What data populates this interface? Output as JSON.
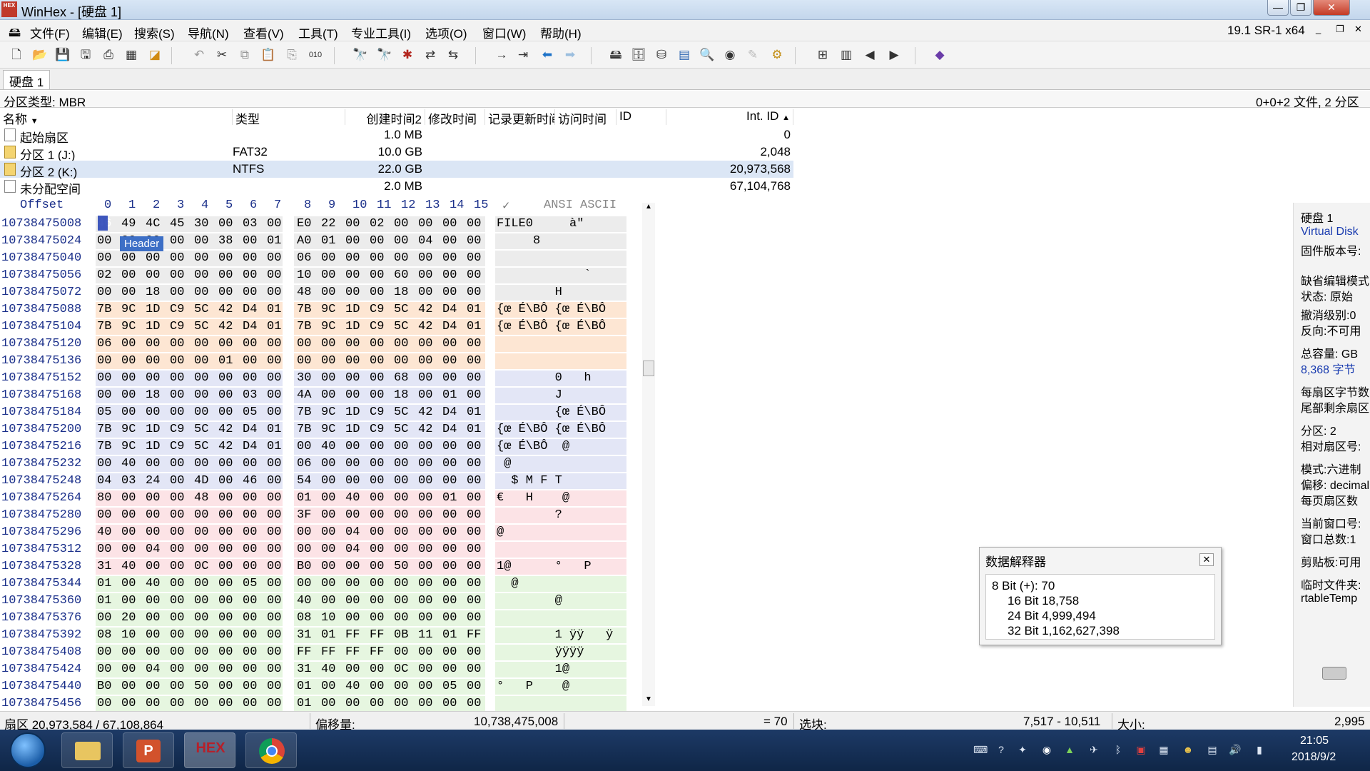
{
  "window": {
    "title": "WinHex - [硬盘 1]",
    "version": "19.1 SR-1 x64",
    "app_icon_text": "HEX"
  },
  "menu": [
    "文件(F)",
    "编辑(E)",
    "搜索(S)",
    "导航(N)",
    "查看(V)",
    "工具(T)",
    "专业工具(I)",
    "选项(O)",
    "窗口(W)",
    "帮助(H)"
  ],
  "tab": {
    "label": "硬盘 1"
  },
  "info": {
    "partition_type": "分区类型: MBR",
    "summary": "0+0+2 文件, 2 分区"
  },
  "partition_list": {
    "headers": [
      "名称",
      "类型",
      "创建时间2",
      "修改时间",
      "记录更新时间",
      "访问时间",
      "ID",
      "Int. ID"
    ],
    "rows": [
      {
        "name": "起始扇区",
        "type": "",
        "size": "1.0 MB",
        "int_id": "0"
      },
      {
        "name": "分区 1 (J:)",
        "type": "FAT32",
        "size": "10.0 GB",
        "int_id": "2,048"
      },
      {
        "name": "分区 2 (K:)",
        "type": "NTFS",
        "size": "22.0 GB",
        "int_id": "20,973,568"
      },
      {
        "name": "未分配空间",
        "type": "",
        "size": "2.0 MB",
        "int_id": "67,104,768"
      }
    ]
  },
  "hex": {
    "offset_header": "Offset",
    "col_headers": [
      "0",
      "1",
      "2",
      "3",
      "4",
      "5",
      "6",
      "7",
      "8",
      "9",
      "10",
      "11",
      "12",
      "13",
      "14",
      "15"
    ],
    "ascii_header": "ANSI ASCII",
    "ascii_pencil": "✓",
    "tooltip": "Header",
    "rows": [
      {
        "off": "10738475008",
        "b": [
          "46",
          "49",
          "4C",
          "45",
          "30",
          "00",
          "03",
          "00",
          "E0",
          "22",
          "00",
          "02",
          "00",
          "00",
          "00",
          "00"
        ],
        "a": "FILE0     à\"     "
      },
      {
        "off": "10738475024",
        "b": [
          "00",
          "00",
          "00",
          "00",
          "00",
          "38",
          "00",
          "01",
          "A0",
          "01",
          "00",
          "00",
          "00",
          "04",
          "00",
          "00"
        ],
        "a": "     8          "
      },
      {
        "off": "10738475040",
        "b": [
          "00",
          "00",
          "00",
          "00",
          "00",
          "00",
          "00",
          "00",
          "06",
          "00",
          "00",
          "00",
          "00",
          "00",
          "00",
          "00"
        ],
        "a": "                "
      },
      {
        "off": "10738475056",
        "b": [
          "02",
          "00",
          "00",
          "00",
          "00",
          "00",
          "00",
          "00",
          "10",
          "00",
          "00",
          "00",
          "60",
          "00",
          "00",
          "00"
        ],
        "a": "            `   "
      },
      {
        "off": "10738475072",
        "b": [
          "00",
          "00",
          "18",
          "00",
          "00",
          "00",
          "00",
          "00",
          "48",
          "00",
          "00",
          "00",
          "18",
          "00",
          "00",
          "00"
        ],
        "a": "        H       "
      },
      {
        "off": "10738475088",
        "b": [
          "7B",
          "9C",
          "1D",
          "C9",
          "5C",
          "42",
          "D4",
          "01",
          "7B",
          "9C",
          "1D",
          "C9",
          "5C",
          "42",
          "D4",
          "01"
        ],
        "a": "{œ É\\BÔ {œ É\\BÔ "
      },
      {
        "off": "10738475104",
        "b": [
          "7B",
          "9C",
          "1D",
          "C9",
          "5C",
          "42",
          "D4",
          "01",
          "7B",
          "9C",
          "1D",
          "C9",
          "5C",
          "42",
          "D4",
          "01"
        ],
        "a": "{œ É\\BÔ {œ É\\BÔ "
      },
      {
        "off": "10738475120",
        "b": [
          "06",
          "00",
          "00",
          "00",
          "00",
          "00",
          "00",
          "00",
          "00",
          "00",
          "00",
          "00",
          "00",
          "00",
          "00",
          "00"
        ],
        "a": "                "
      },
      {
        "off": "10738475136",
        "b": [
          "00",
          "00",
          "00",
          "00",
          "00",
          "01",
          "00",
          "00",
          "00",
          "00",
          "00",
          "00",
          "00",
          "00",
          "00",
          "00"
        ],
        "a": "                "
      },
      {
        "off": "10738475152",
        "b": [
          "00",
          "00",
          "00",
          "00",
          "00",
          "00",
          "00",
          "00",
          "30",
          "00",
          "00",
          "00",
          "68",
          "00",
          "00",
          "00"
        ],
        "a": "        0   h   "
      },
      {
        "off": "10738475168",
        "b": [
          "00",
          "00",
          "18",
          "00",
          "00",
          "00",
          "03",
          "00",
          "4A",
          "00",
          "00",
          "00",
          "18",
          "00",
          "01",
          "00"
        ],
        "a": "        J       "
      },
      {
        "off": "10738475184",
        "b": [
          "05",
          "00",
          "00",
          "00",
          "00",
          "00",
          "05",
          "00",
          "7B",
          "9C",
          "1D",
          "C9",
          "5C",
          "42",
          "D4",
          "01"
        ],
        "a": "        {œ É\\BÔ "
      },
      {
        "off": "10738475200",
        "b": [
          "7B",
          "9C",
          "1D",
          "C9",
          "5C",
          "42",
          "D4",
          "01",
          "7B",
          "9C",
          "1D",
          "C9",
          "5C",
          "42",
          "D4",
          "01"
        ],
        "a": "{œ É\\BÔ {œ É\\BÔ "
      },
      {
        "off": "10738475216",
        "b": [
          "7B",
          "9C",
          "1D",
          "C9",
          "5C",
          "42",
          "D4",
          "01",
          "00",
          "40",
          "00",
          "00",
          "00",
          "00",
          "00",
          "00"
        ],
        "a": "{œ É\\BÔ  @      "
      },
      {
        "off": "10738475232",
        "b": [
          "00",
          "40",
          "00",
          "00",
          "00",
          "00",
          "00",
          "00",
          "06",
          "00",
          "00",
          "00",
          "00",
          "00",
          "00",
          "00"
        ],
        "a": " @              "
      },
      {
        "off": "10738475248",
        "b": [
          "04",
          "03",
          "24",
          "00",
          "4D",
          "00",
          "46",
          "00",
          "54",
          "00",
          "00",
          "00",
          "00",
          "00",
          "00",
          "00"
        ],
        "a": "  $ M F T       "
      },
      {
        "off": "10738475264",
        "b": [
          "80",
          "00",
          "00",
          "00",
          "48",
          "00",
          "00",
          "00",
          "01",
          "00",
          "40",
          "00",
          "00",
          "00",
          "01",
          "00"
        ],
        "a": "€   H    @      "
      },
      {
        "off": "10738475280",
        "b": [
          "00",
          "00",
          "00",
          "00",
          "00",
          "00",
          "00",
          "00",
          "3F",
          "00",
          "00",
          "00",
          "00",
          "00",
          "00",
          "00"
        ],
        "a": "        ?       "
      },
      {
        "off": "10738475296",
        "b": [
          "40",
          "00",
          "00",
          "00",
          "00",
          "00",
          "00",
          "00",
          "00",
          "00",
          "04",
          "00",
          "00",
          "00",
          "00",
          "00"
        ],
        "a": "@               "
      },
      {
        "off": "10738475312",
        "b": [
          "00",
          "00",
          "04",
          "00",
          "00",
          "00",
          "00",
          "00",
          "00",
          "00",
          "04",
          "00",
          "00",
          "00",
          "00",
          "00"
        ],
        "a": "                "
      },
      {
        "off": "10738475328",
        "b": [
          "31",
          "40",
          "00",
          "00",
          "0C",
          "00",
          "00",
          "00",
          "B0",
          "00",
          "00",
          "00",
          "50",
          "00",
          "00",
          "00"
        ],
        "a": "1@      °   P   "
      },
      {
        "off": "10738475344",
        "b": [
          "01",
          "00",
          "40",
          "00",
          "00",
          "00",
          "05",
          "00",
          "00",
          "00",
          "00",
          "00",
          "00",
          "00",
          "00",
          "00"
        ],
        "a": "  @             "
      },
      {
        "off": "10738475360",
        "b": [
          "01",
          "00",
          "00",
          "00",
          "00",
          "00",
          "00",
          "00",
          "40",
          "00",
          "00",
          "00",
          "00",
          "00",
          "00",
          "00"
        ],
        "a": "        @       "
      },
      {
        "off": "10738475376",
        "b": [
          "00",
          "20",
          "00",
          "00",
          "00",
          "00",
          "00",
          "00",
          "08",
          "10",
          "00",
          "00",
          "00",
          "00",
          "00",
          "00"
        ],
        "a": "                "
      },
      {
        "off": "10738475392",
        "b": [
          "08",
          "10",
          "00",
          "00",
          "00",
          "00",
          "00",
          "00",
          "31",
          "01",
          "FF",
          "FF",
          "0B",
          "11",
          "01",
          "FF"
        ],
        "a": "        1 ÿÿ   ÿ"
      },
      {
        "off": "10738475408",
        "b": [
          "00",
          "00",
          "00",
          "00",
          "00",
          "00",
          "00",
          "00",
          "FF",
          "FF",
          "FF",
          "FF",
          "00",
          "00",
          "00",
          "00"
        ],
        "a": "        ÿÿÿÿ    "
      },
      {
        "off": "10738475424",
        "b": [
          "00",
          "00",
          "04",
          "00",
          "00",
          "00",
          "00",
          "00",
          "31",
          "40",
          "00",
          "00",
          "0C",
          "00",
          "00",
          "00"
        ],
        "a": "        1@      "
      },
      {
        "off": "10738475440",
        "b": [
          "B0",
          "00",
          "00",
          "00",
          "50",
          "00",
          "00",
          "00",
          "01",
          "00",
          "40",
          "00",
          "00",
          "00",
          "05",
          "00"
        ],
        "a": "°   P    @      "
      },
      {
        "off": "10738475456",
        "b": [
          "00",
          "00",
          "00",
          "00",
          "00",
          "00",
          "00",
          "00",
          "01",
          "00",
          "00",
          "00",
          "00",
          "00",
          "00",
          "00"
        ],
        "a": "                "
      }
    ]
  },
  "right_panel": [
    {
      "t": "硬盘 1",
      "blue": false
    },
    {
      "t": "Virtual Disk",
      "blue": true
    },
    {
      "t": "固件版本号:",
      "blue": false
    },
    {
      "t": "缺省编辑模式",
      "blue": false
    },
    {
      "t": "状态:  原始",
      "blue": false
    },
    {
      "t": "撤消级别:0",
      "blue": false
    },
    {
      "t": "反向:不可用",
      "blue": false
    },
    {
      "t": "总容量: GB",
      "blue": false
    },
    {
      "t": "8,368 字节",
      "blue": true
    },
    {
      "t": "每扇区字节数",
      "blue": false
    },
    {
      "t": "尾部剩余扇区",
      "blue": false
    },
    {
      "t": "分区:   2",
      "blue": false
    },
    {
      "t": "相对扇区号:",
      "blue": false
    },
    {
      "t": "模式:六进制",
      "blue": false
    },
    {
      "t": "偏移: decimal",
      "blue": false
    },
    {
      "t": "每页扇区数",
      "blue": false
    },
    {
      "t": "当前窗口号:",
      "blue": false
    },
    {
      "t": "窗口总数:1",
      "blue": false
    },
    {
      "t": "剪贴板:可用",
      "blue": false
    },
    {
      "t": "临时文件夹:",
      "blue": false
    },
    {
      "t": "rtableTemp",
      "blue": false
    }
  ],
  "interpreter": {
    "title": "数据解释器",
    "rows": [
      "8 Bit (+): 70",
      "16 Bit 18,758",
      "24 Bit 4,999,494",
      "32 Bit 1,162,627,398"
    ]
  },
  "status": {
    "sector": "扇区 20,973,584 / 67,108,864",
    "offset_label": "偏移量:",
    "offset_value": "10,738,475,008",
    "eq": "= 70",
    "block_label": "选块:",
    "block_value": "7,517 - 10,511",
    "size_label": "大小:",
    "size_value": "2,995"
  },
  "taskbar": {
    "time": "21:05",
    "date": "2018/9/2",
    "hex_label": "HEX"
  },
  "colors": {
    "accent": "#1e3cb4",
    "offset_blue": "#1a2f8a",
    "blk_gray": "#ececec",
    "blk_orange": "#fde6d3",
    "blk_blue": "#e3e6f6",
    "blk_pink": "#fce3e6",
    "blk_green": "#e6f6e0"
  }
}
